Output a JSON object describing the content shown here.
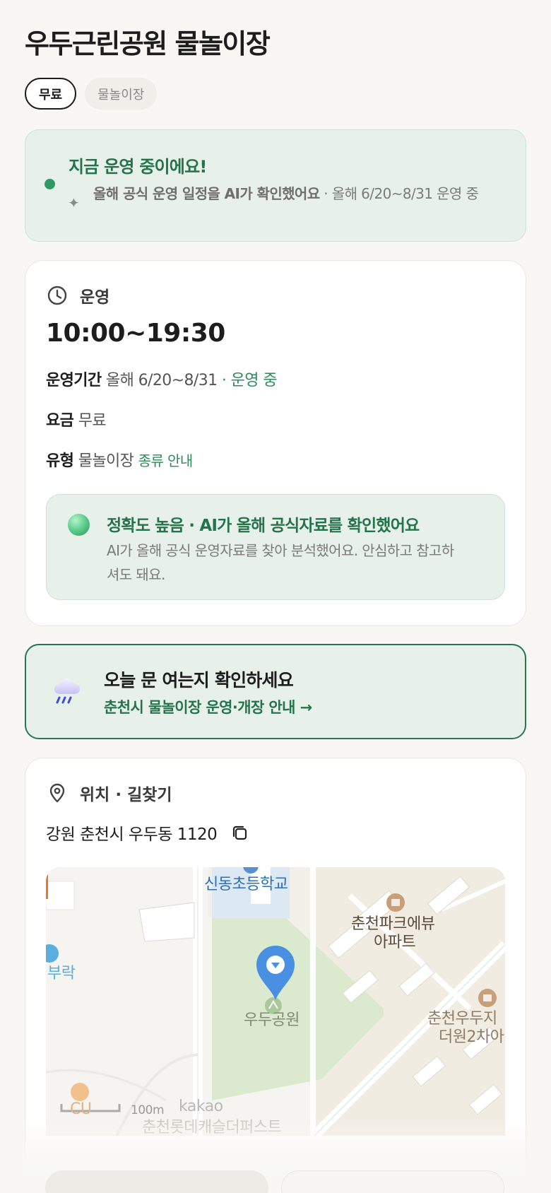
{
  "header": {
    "title": "우두근린공원 물놀이장",
    "chips": [
      "무료",
      "물놀이장"
    ]
  },
  "status": {
    "title": "지금 운영 중이에요!",
    "sub_bold": "올해 공식 운영 일정을 AI가 확인했어요",
    "sub_rest": " · 올해 6/20~8/31 운영 중"
  },
  "info": {
    "section_label": "운영",
    "hours": "10:00~19:30",
    "period_key": "운영기간",
    "period_value": "올해 6/20~8/31",
    "period_dot": " · ",
    "period_status": "운영 중",
    "fee_key": "요금",
    "fee_value": "무료",
    "type_key": "유형",
    "type_value": "물놀이장",
    "type_link": "종류 안내",
    "accuracy": {
      "title": "정확도 높음 · AI가 올해 공식자료를 확인했어요",
      "desc": "AI가 올해 공식 운영자료를 찾아 분석했어요. 안심하고 참고하셔도 돼요."
    }
  },
  "weather": {
    "title": "오늘 문 여는지 확인하세요",
    "link": "춘천시 물놀이장 운영·개장 안내 →"
  },
  "location": {
    "section_label": "위치 · 길찾기",
    "address": "강원 춘천시 우두동 1120",
    "map": {
      "labels": {
        "school": "신동초등학교",
        "apt1a": "춘천파크에뷰",
        "apt1b": "아파트",
        "park": "우두공원",
        "left": "부락",
        "apt2a": "춘천우두지",
        "apt2b": "더원2차아",
        "store": "CU",
        "bottom": "춘천롯데캐슬더퍼스트",
        "scale": "100m",
        "brand": "kakao"
      }
    }
  },
  "colors": {
    "accent_green": "#24744b",
    "status_dot": "#2e9a63",
    "card_tint": "#e8f0ea",
    "pin_blue": "#4a90e2"
  }
}
